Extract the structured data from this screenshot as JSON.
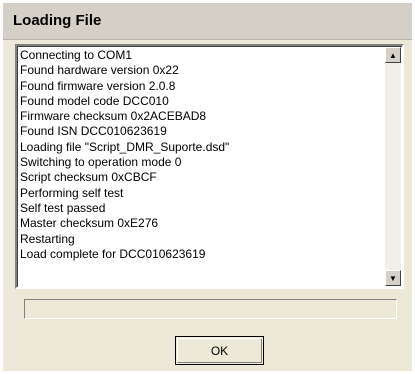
{
  "window": {
    "title": "Loading File"
  },
  "log": {
    "lines": [
      "Connecting to COM1",
      "Found hardware version 0x22",
      "Found firmware version 2.0.8",
      "Found model code DCC010",
      "Firmware checksum 0x2ACEBAD8",
      "Found ISN DCC010623619",
      "Loading file \"Script_DMR_Suporte.dsd\"",
      "Switching to operation mode 0",
      "Script checksum 0xCBCF",
      "Performing self test",
      "Self test passed",
      "Master checksum 0xE276",
      "Restarting",
      "Load complete for DCC010623619"
    ]
  },
  "scrollbar": {
    "up_icon": "arrow-up-icon",
    "down_icon": "arrow-down-icon"
  },
  "progress": {
    "value": 0
  },
  "buttons": {
    "ok_label": "OK"
  }
}
